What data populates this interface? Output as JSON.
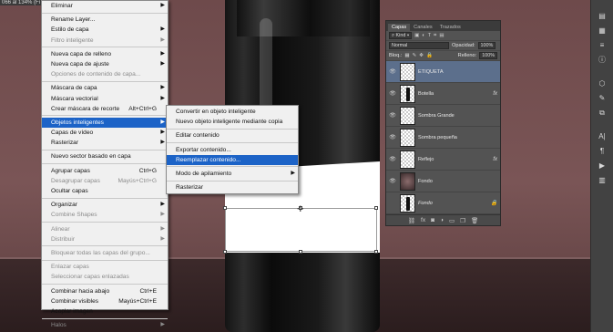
{
  "window": {
    "title": "066 al 134% (Fi"
  },
  "context_menu": {
    "items": [
      {
        "label": "Eliminar",
        "arrow": true
      },
      {
        "sep": true
      },
      {
        "label": "Rename Layer..."
      },
      {
        "label": "Estilo de capa",
        "arrow": true
      },
      {
        "label": "Filtro inteligente",
        "disabled": true,
        "arrow": true
      },
      {
        "sep": true
      },
      {
        "label": "Nueva capa de relleno",
        "arrow": true
      },
      {
        "label": "Nueva capa de ajuste",
        "arrow": true
      },
      {
        "label": "Opciones de contenido de capa...",
        "disabled": true
      },
      {
        "sep": true
      },
      {
        "label": "Máscara de capa",
        "arrow": true
      },
      {
        "label": "Máscara vectorial",
        "arrow": true
      },
      {
        "label": "Crear máscara de recorte",
        "shortcut": "Alt+Ctrl+G"
      },
      {
        "sep": true
      },
      {
        "label": "Objetos inteligentes",
        "arrow": true,
        "active": true
      },
      {
        "label": "Capas de vídeo",
        "arrow": true
      },
      {
        "label": "Rasterizar",
        "arrow": true
      },
      {
        "sep": true
      },
      {
        "label": "Nuevo sector basado en capa"
      },
      {
        "sep": true
      },
      {
        "label": "Agrupar capas",
        "shortcut": "Ctrl+G"
      },
      {
        "label": "Desagrupar capas",
        "shortcut": "Mayús+Ctrl+G",
        "disabled": true
      },
      {
        "label": "Ocultar capas"
      },
      {
        "sep": true
      },
      {
        "label": "Organizar",
        "arrow": true
      },
      {
        "label": "Combine Shapes",
        "arrow": true,
        "disabled": true
      },
      {
        "sep": true
      },
      {
        "label": "Alinear",
        "arrow": true,
        "disabled": true
      },
      {
        "label": "Distribuir",
        "arrow": true,
        "disabled": true
      },
      {
        "sep": true
      },
      {
        "label": "Bloquear todas las capas del grupo...",
        "disabled": true
      },
      {
        "sep": true
      },
      {
        "label": "Enlazar capas",
        "disabled": true
      },
      {
        "label": "Seleccionar capas enlazadas",
        "disabled": true
      },
      {
        "sep": true
      },
      {
        "label": "Combinar hacia abajo",
        "shortcut": "Ctrl+E"
      },
      {
        "label": "Combinar visibles",
        "shortcut": "Mayús+Ctrl+E"
      },
      {
        "label": "Acoplar imagen"
      },
      {
        "sep": true
      },
      {
        "label": "Halos",
        "arrow": true,
        "disabled": true
      }
    ]
  },
  "submenu": {
    "items": [
      {
        "label": "Convertir en objeto inteligente"
      },
      {
        "label": "Nuevo objeto inteligente mediante copia"
      },
      {
        "sep": true
      },
      {
        "label": "Editar contenido"
      },
      {
        "sep": true
      },
      {
        "label": "Exportar contenido..."
      },
      {
        "label": "Reemplazar contenido...",
        "active": true
      },
      {
        "sep": true
      },
      {
        "label": "Modo de apilamiento",
        "arrow": true
      },
      {
        "sep": true
      },
      {
        "label": "Rasterizar"
      }
    ]
  },
  "layers_panel": {
    "tabs": [
      "Capas",
      "Canales",
      "Trazados"
    ],
    "kind_filter": "Kind",
    "blend_mode": "Normal",
    "opacity_label": "Opacidad:",
    "opacity_value": "100%",
    "lock_label": "Bloq.:",
    "fill_label": "Relleno:",
    "fill_value": "100%",
    "layers": [
      {
        "name": "ETIQUETA",
        "selected": true,
        "thumb": "checker"
      },
      {
        "name": "Botella",
        "fx": "fx",
        "thumb": "bottle"
      },
      {
        "name": "Sombra Grande",
        "thumb": "checker"
      },
      {
        "name": "Sombra pequeña",
        "thumb": "checker"
      },
      {
        "name": "Reflejo",
        "fx": "fx",
        "thumb": "checker"
      },
      {
        "name": "Fondo",
        "thumb": "dark"
      },
      {
        "name": "Fondo",
        "italic": true,
        "locked": true,
        "thumb": "bottle",
        "hidden": true
      }
    ],
    "footer_icons": [
      "link-icon",
      "fx-icon",
      "mask-icon",
      "adjustment-icon",
      "folder-icon",
      "new-layer-icon",
      "trash-icon"
    ]
  },
  "colors": {
    "accent": "#1c63c7",
    "panel": "#535353",
    "selected_layer": "#5c6f8c"
  }
}
